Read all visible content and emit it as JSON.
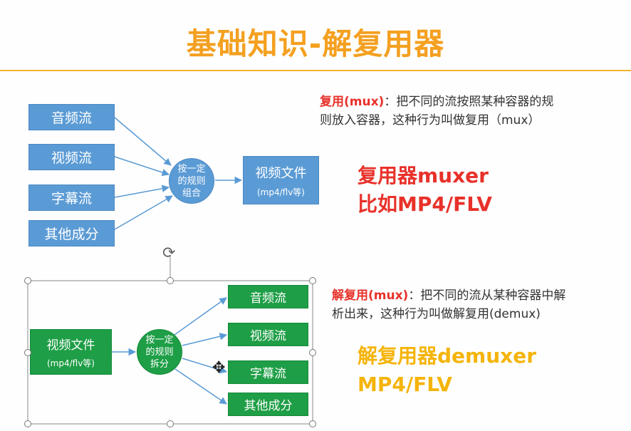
{
  "title": "基础知识-解复用器",
  "mux": {
    "inputs": [
      "音频流",
      "视频流",
      "字幕流",
      "其他成分"
    ],
    "process": [
      "按一定",
      "的规则",
      "组合"
    ],
    "output_title": "视频文件",
    "output_sub": "(mp4/flv等)",
    "desc_term": "复用(mux)",
    "desc_line1": "：把不同的流按照某种容器的规",
    "desc_line2": "则放入容器，这种行为叫做复用（mux）",
    "big_line1": "复用器muxer",
    "big_line2": "比如MP4/FLV",
    "big_color": "#e8312a"
  },
  "demux": {
    "input_title": "视频文件",
    "input_sub": "(mp4/flv等)",
    "process": [
      "按一定",
      "的规则",
      "拆分"
    ],
    "outputs": [
      "音频流",
      "视频流",
      "字幕流",
      "其他成分"
    ],
    "desc_term": "解复用(mux)",
    "desc_line1": "：把不同的流从某种容器中解",
    "desc_line2": "析出来，这种行为叫做解复用(demux)",
    "big_line1": "解复用器demuxer",
    "big_line2": "MP4/FLV",
    "big_color": "#f5b40a"
  },
  "icons": {
    "rotate": "rotate-handle-icon",
    "cursor": "move-cursor-icon"
  }
}
